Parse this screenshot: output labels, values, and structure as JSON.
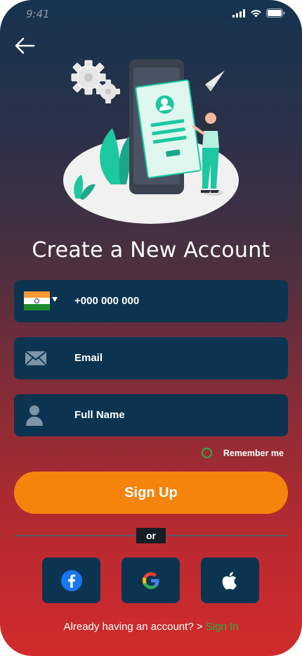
{
  "status_bar": {
    "time": "9:41",
    "icons": [
      "signal-icon",
      "wifi-icon",
      "battery-icon"
    ]
  },
  "header": {
    "back_icon": "arrow-left-icon"
  },
  "illustration": {
    "name": "signup-illustration"
  },
  "title": "Create a New Account",
  "form": {
    "phone": {
      "country_flag": "india-flag-icon",
      "placeholder": "+000 000 000"
    },
    "email": {
      "icon": "envelope-icon",
      "placeholder": "Email"
    },
    "full_name": {
      "icon": "user-icon",
      "placeholder": "Full Name"
    },
    "remember_me": {
      "label": "Remember me",
      "checked": false
    },
    "submit_label": "Sign Up"
  },
  "divider_label": "or",
  "social_buttons": [
    {
      "name": "facebook",
      "icon": "facebook-icon"
    },
    {
      "name": "google",
      "icon": "google-icon"
    },
    {
      "name": "apple",
      "icon": "apple-icon"
    }
  ],
  "footer": {
    "prompt": "Already having an account? > ",
    "link": "Sign In"
  },
  "colors": {
    "accent": "#f5840c",
    "field_bg": "#0c3450",
    "link": "#2bb04d"
  }
}
